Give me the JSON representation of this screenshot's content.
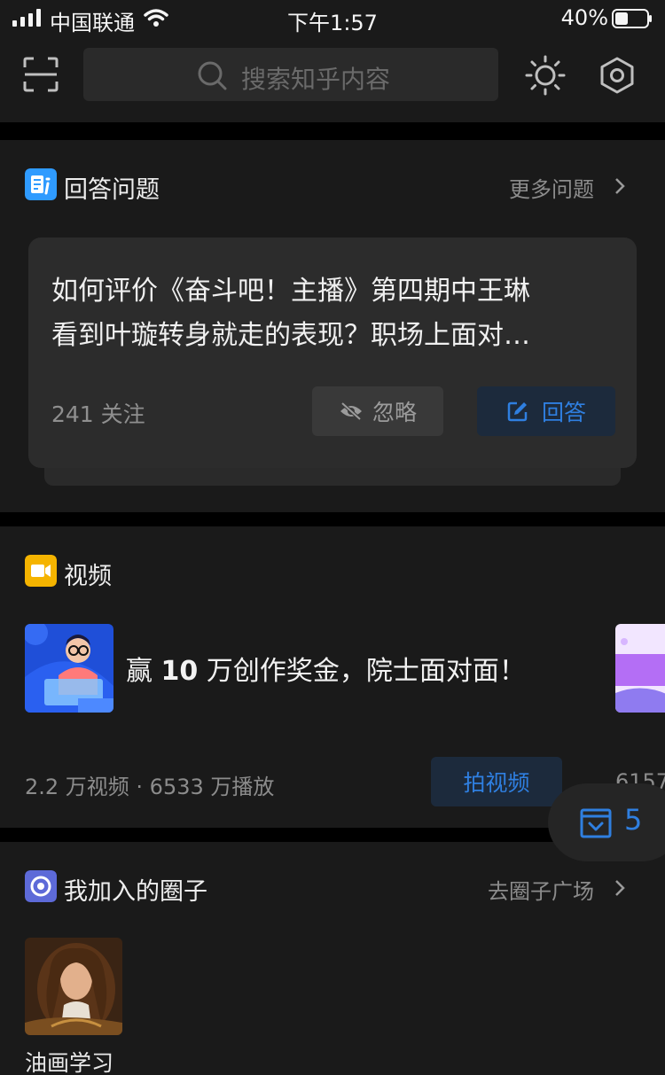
{
  "status_bar": {
    "carrier": "中国联通",
    "time": "下午1:57",
    "battery": "40%"
  },
  "topbar": {
    "search_placeholder": "搜索知乎内容",
    "icons": [
      "scan-icon",
      "search-icon",
      "sun-icon",
      "hexagon-settings-icon"
    ]
  },
  "answer_section": {
    "title": "回答问题",
    "more": "更多问题",
    "question": {
      "line1": "如何评价《奋斗吧！主播》第四期中王琳",
      "line2": "看到叶璇转身就走的表现？职场上面对…",
      "followers": "241 关注",
      "ignore_label": "忽略",
      "answer_label": "回答"
    }
  },
  "video_section": {
    "title": "视频",
    "item": {
      "title_pre": "赢 ",
      "title_bold": "10",
      "title_post": " 万创作奖金，院士面对面！",
      "stats": "2.2 万视频 · 6533 万播放",
      "action": "拍视频"
    },
    "next_stats": "6157"
  },
  "float_tray": {
    "count": "5"
  },
  "circles_section": {
    "title": "我加入的圈子",
    "more": "去圈子广场",
    "items": [
      {
        "label": "油画学习"
      }
    ]
  },
  "colors": {
    "accent": "#2f7fe0",
    "card_bg": "#1a1a1a",
    "page_bg": "#000000",
    "answer_icon": "#2f9bff",
    "video_icon": "#f5b400",
    "circle_icon": "#5d6ad8"
  }
}
